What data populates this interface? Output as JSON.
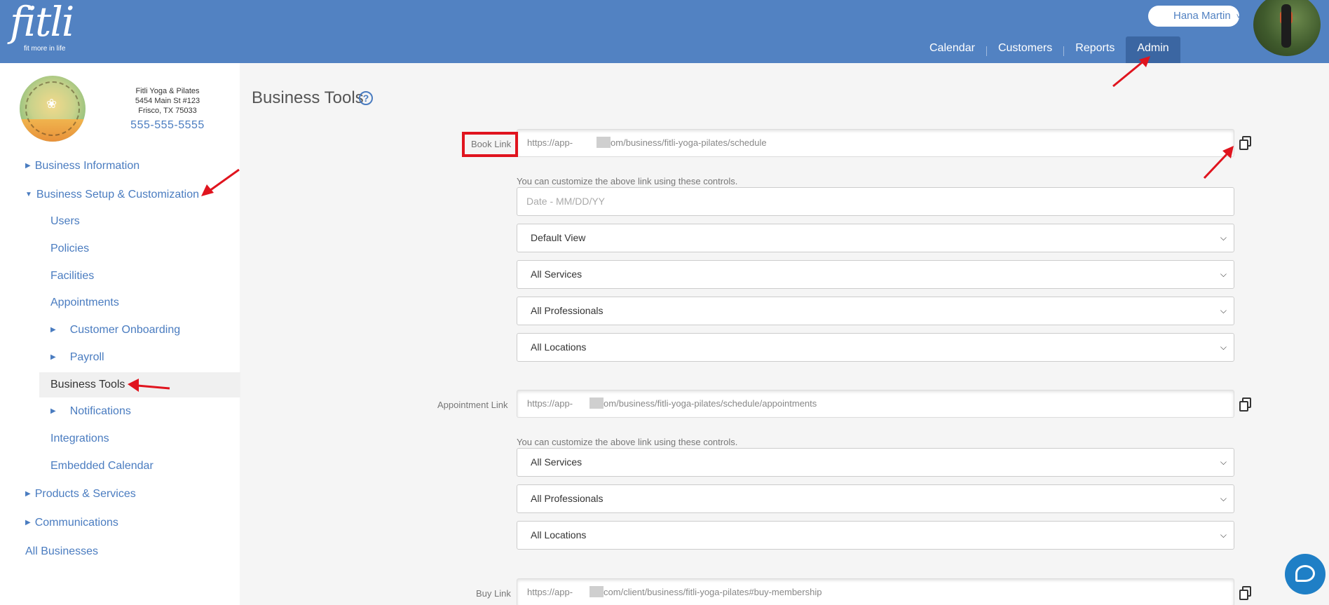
{
  "header": {
    "logo_text": "fitli",
    "logo_tagline": "fit more in life",
    "user_name": "Hana Martin",
    "nav": [
      {
        "label": "Calendar"
      },
      {
        "label": "Customers"
      },
      {
        "label": "Reports"
      },
      {
        "label": "Admin"
      }
    ]
  },
  "business": {
    "name": "Fitli Yoga & Pilates",
    "address_line1": "5454 Main St #123",
    "address_line2": "Frisco, TX 75033",
    "phone": "555-555-5555"
  },
  "sidebar": {
    "items": [
      {
        "label": "Business Information"
      },
      {
        "label": "Business Setup & Customization"
      },
      {
        "label": "Users"
      },
      {
        "label": "Policies"
      },
      {
        "label": "Facilities"
      },
      {
        "label": "Appointments"
      },
      {
        "label": "Customer Onboarding"
      },
      {
        "label": "Payroll"
      },
      {
        "label": "Business Tools"
      },
      {
        "label": "Notifications"
      },
      {
        "label": "Integrations"
      },
      {
        "label": "Embedded Calendar"
      },
      {
        "label": "Products & Services"
      },
      {
        "label": "Communications"
      },
      {
        "label": "All Businesses"
      }
    ]
  },
  "main": {
    "title": "Business Tools",
    "book_link": {
      "label": "Book Link",
      "url_start": "https://app-",
      "url_end": "om/business/fitli-yoga-pilates/schedule"
    },
    "hint": "You can customize the above link using these controls.",
    "date_placeholder": "Date - MM/DD/YY",
    "book_selects": [
      "Default View",
      "All Services",
      "All Professionals",
      "All Locations"
    ],
    "appointment_link": {
      "label": "Appointment Link",
      "url_start": "https://app-",
      "url_end": "om/business/fitli-yoga-pilates/schedule/appointments"
    },
    "appointment_selects": [
      "All Services",
      "All Professionals",
      "All Locations"
    ],
    "buy_link": {
      "label": "Buy Link",
      "url_start": "https://app-",
      "url_end": "com/client/business/fitli-yoga-pilates#buy-membership"
    }
  },
  "colors": {
    "header_bg": "#5282c2",
    "accent": "#4a7cc0",
    "annotation_red": "#e0141e"
  }
}
